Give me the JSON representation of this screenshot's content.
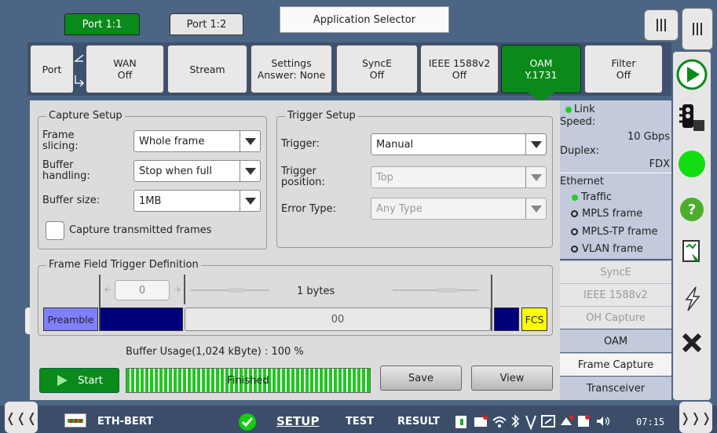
{
  "top_tabs": {
    "port_1_1": "Port 1:1",
    "port_1_2": "Port 1:2",
    "app_selector": "Application Selector"
  },
  "port_tabs": [
    {
      "l1": "Port",
      "l2": ""
    },
    {
      "l1": "WAN",
      "l2": "Off"
    },
    {
      "l1": "Stream",
      "l2": ""
    },
    {
      "l1": "Settings",
      "l2": "Answer: None"
    },
    {
      "l1": "SyncE",
      "l2": "Off"
    },
    {
      "l1": "IEEE 1588v2",
      "l2": "Off"
    },
    {
      "l1": "OAM",
      "l2": "Y.1731"
    },
    {
      "l1": "Filter",
      "l2": "Off"
    }
  ],
  "capture_setup": {
    "title": "Capture Setup",
    "frame_slicing_label": "Frame\nslicing:",
    "frame_slicing": "Whole frame",
    "buffer_handling_label": "Buffer\nhandling:",
    "buffer_handling": "Stop when full",
    "buffer_size_label": "Buffer size:",
    "buffer_size": "1MB",
    "capture_tx_label": "Capture transmitted frames",
    "capture_tx": false
  },
  "trigger_setup": {
    "title": "Trigger Setup",
    "trigger_label": "Trigger:",
    "trigger": "Manual",
    "trigger_position_label": "Trigger\nposition:",
    "trigger_position": "Top",
    "error_type_label": "Error Type:",
    "error_type": "Any Type"
  },
  "frame_field": {
    "title": "Frame Field Trigger Definition",
    "offset": "0",
    "bytes": "1 bytes",
    "preamble": "Preamble",
    "value": "00",
    "fcs": "FCS"
  },
  "buffer": {
    "usage_text": "Buffer Usage(1,024 kByte) : 100 %",
    "status": "Finished",
    "progress": 1.0
  },
  "actions": {
    "start": "Start",
    "save": "Save",
    "view": "View"
  },
  "right_panel": {
    "link": "Link",
    "speed_label": "Speed:",
    "speed": "10 Gbps",
    "duplex_label": "Duplex:",
    "duplex": "FDX",
    "ethernet": "Ethernet",
    "traffic": "Traffic",
    "mpls": "MPLS frame",
    "mpls_tp": "MPLS-TP frame",
    "vlan": "VLAN frame",
    "items": [
      "SyncE",
      "IEEE 1588v2",
      "OH Capture",
      "OAM",
      "Frame Capture",
      "Transceiver"
    ]
  },
  "bottom": {
    "app": "ETH-BERT",
    "setup": "SETUP",
    "test": "TEST",
    "result": "RESULT",
    "time": "07:15"
  },
  "colors": {
    "accent_green": "#0a8a0a",
    "preamble": "#8080ff",
    "field_blue": "#00007a",
    "fcs": "#ffff00",
    "bg": "#4d6585"
  }
}
